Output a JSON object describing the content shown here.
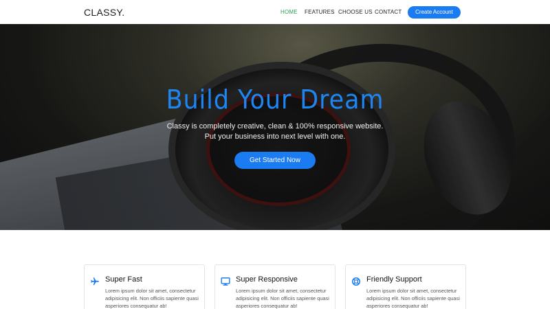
{
  "nav": {
    "logo": "CLASSY.",
    "links": [
      {
        "label": "HOME",
        "active": true
      },
      {
        "label": "FEATURES",
        "active": false
      },
      {
        "label": "CHOOSE US",
        "active": false
      },
      {
        "label": "CONTACT",
        "active": false
      }
    ],
    "cta_label": "Create Account"
  },
  "hero": {
    "title": "Build Your Dream",
    "subtitle_line1": "Classy is completely creative, clean & 100% responsive website.",
    "subtitle_line2": "Put your business into next level with one.",
    "button_label": "Get Started Now"
  },
  "features": [
    {
      "icon": "airplane-icon",
      "title": "Super Fast",
      "text": "Lorem ipsum dolor sit amet, consectetur adipisicing elit. Non officiis sapiente quasi asperiores consequatur ab!"
    },
    {
      "icon": "monitor-icon",
      "title": "Super Responsive",
      "text": "Lorem ipsum dolor sit amet, consectetur adipisicing elit. Non officiis sapiente quasi asperiores consequatur ab!"
    },
    {
      "icon": "lifebuoy-icon",
      "title": "Friendly Support",
      "text": "Lorem ipsum dolor sit amet, consectetur adipisicing elit. Non officiis sapiente quasi asperiores consequatur ab!"
    }
  ],
  "colors": {
    "accent": "#1a7cf0",
    "nav_active": "#2e9c58",
    "hero_title": "#1e86f2"
  }
}
